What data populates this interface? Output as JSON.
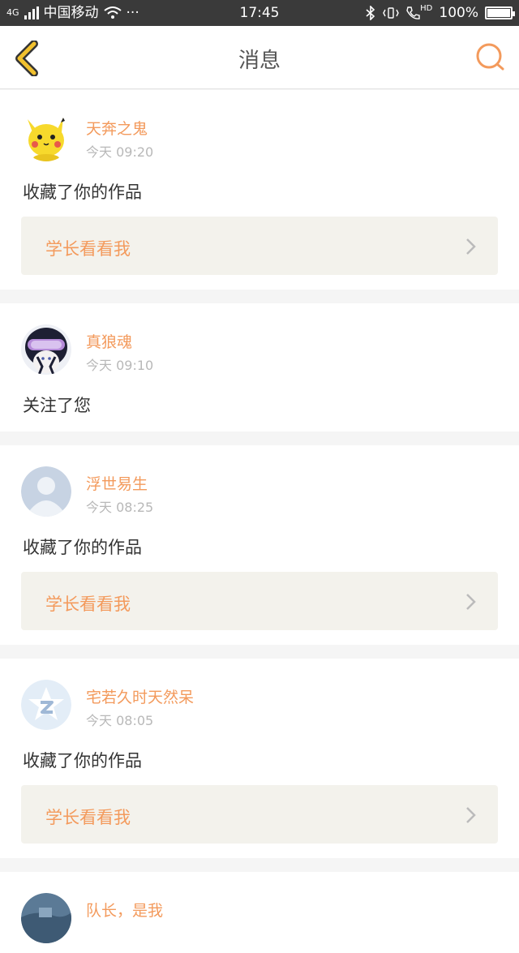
{
  "status_bar": {
    "network": "4G",
    "carrier": "中国移动",
    "more": "···",
    "time": "17:45",
    "hd": "HD",
    "battery": "100%",
    "battery_level": 1.0
  },
  "nav": {
    "title": "消息"
  },
  "notifications": [
    {
      "user": "天奔之鬼",
      "time": "今天 09:20",
      "action": "收藏了你的作品",
      "work_title": "学长看看我"
    },
    {
      "user": "真狼魂",
      "time": "今天 09:10",
      "action": "关注了您"
    },
    {
      "user": "浮世易生",
      "time": "今天 08:25",
      "action": "收藏了你的作品",
      "work_title": "学长看看我"
    },
    {
      "user": "宅若久时天然呆",
      "time": "今天 08:05",
      "action": "收藏了你的作品",
      "work_title": "学长看看我"
    },
    {
      "user": "队长，是我"
    }
  ],
  "colors": {
    "accent": "#f39a5c",
    "back_icon": "#f2c12e",
    "status_bar_bg": "#3a3a3a",
    "card_bg": "#ffffff",
    "work_bg": "#f3f2ec"
  }
}
